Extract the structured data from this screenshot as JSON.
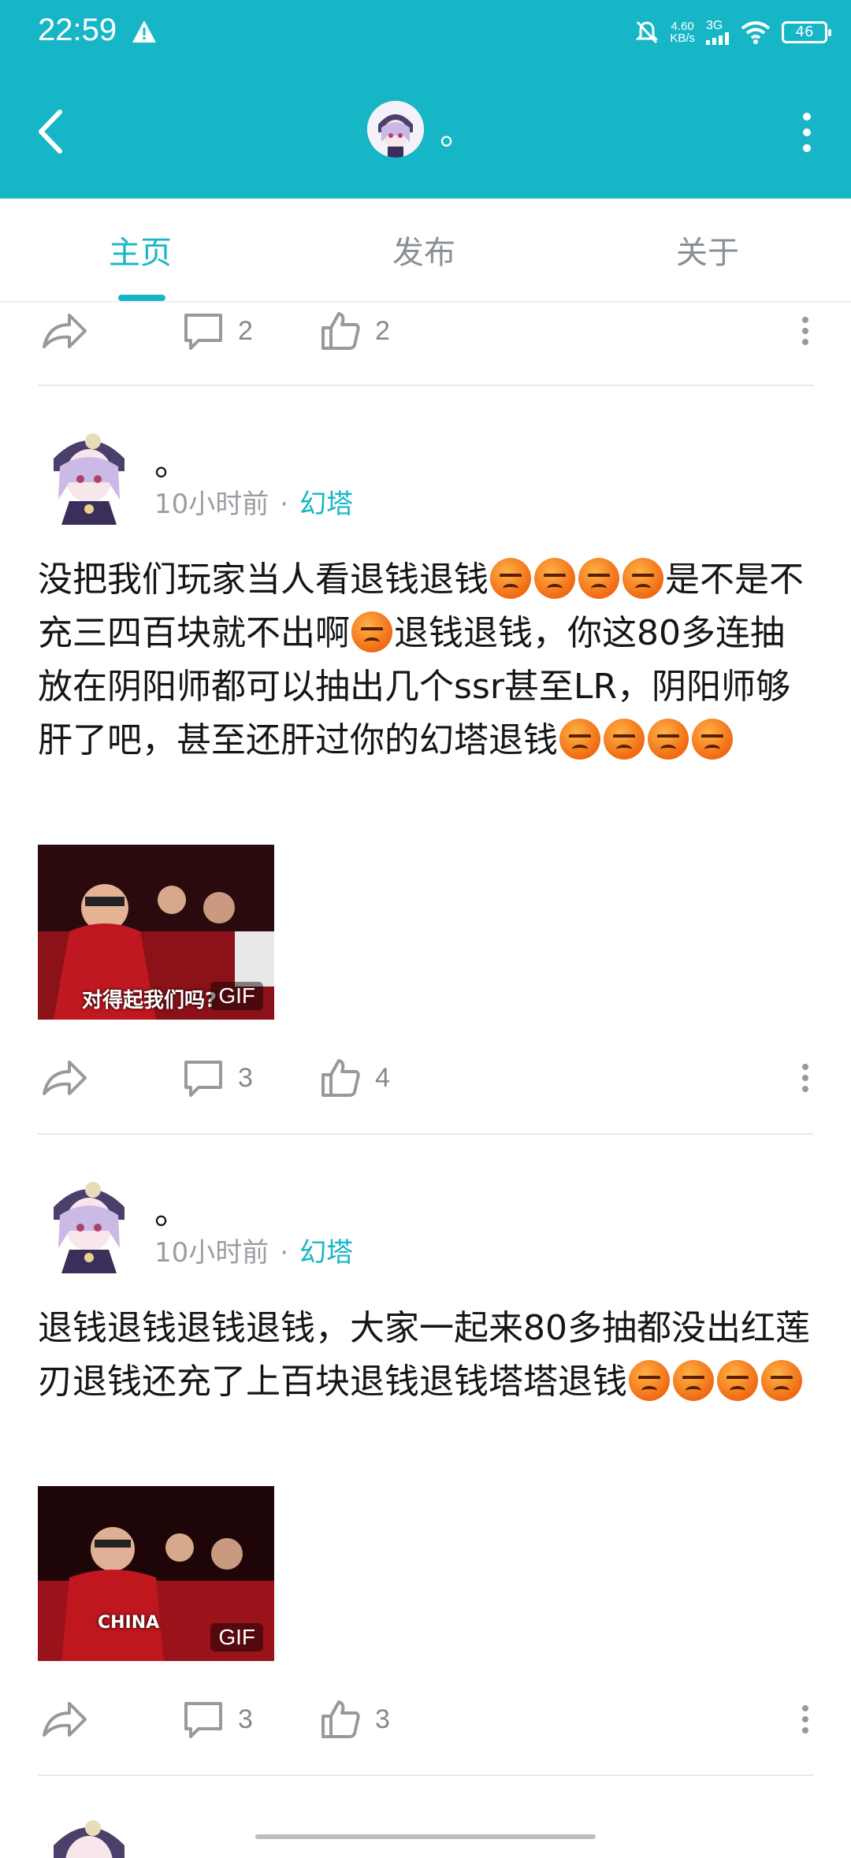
{
  "status_bar": {
    "time": "22:59",
    "net_speed_value": "4.60",
    "net_speed_unit": "KB/s",
    "network": "3G",
    "battery": "46"
  },
  "header": {
    "name": "。"
  },
  "tabs": [
    {
      "label": "主页"
    },
    {
      "label": "发布"
    },
    {
      "label": "关于"
    }
  ],
  "top_actions": {
    "comments": "2",
    "likes": "2"
  },
  "posts": [
    {
      "author": "。",
      "time": "10小时前",
      "dot": "·",
      "tag": "幻塔",
      "body": [
        "没把我们玩家当人看退钱退钱",
        "😡",
        "😡",
        "😡",
        "😡",
        "是不是不充三四百块就不出啊",
        "😡",
        "退钱退钱，你这80多连抽放在阴阳师都可以抽出几个ssr甚至LR，阴阳师够肝了吧，甚至还肝过你的幻塔退钱",
        "😡",
        "😡",
        "😡",
        "😡"
      ],
      "gif_caption": "对得起我们吗?",
      "gif_badge": "GIF",
      "comments": "3",
      "likes": "4"
    },
    {
      "author": "。",
      "time": "10小时前",
      "dot": "·",
      "tag": "幻塔",
      "body": [
        "退钱退钱退钱退钱，大家一起来80多抽都没出红莲刃退钱还充了上百块退钱退钱塔塔退钱",
        "😡",
        "😡",
        "😡",
        "😡"
      ],
      "gif_caption": "CHINA",
      "gif_badge": "GIF",
      "comments": "3",
      "likes": "3"
    }
  ],
  "colors": {
    "accent": "#17b6c6",
    "muted": "#8a8f94"
  }
}
